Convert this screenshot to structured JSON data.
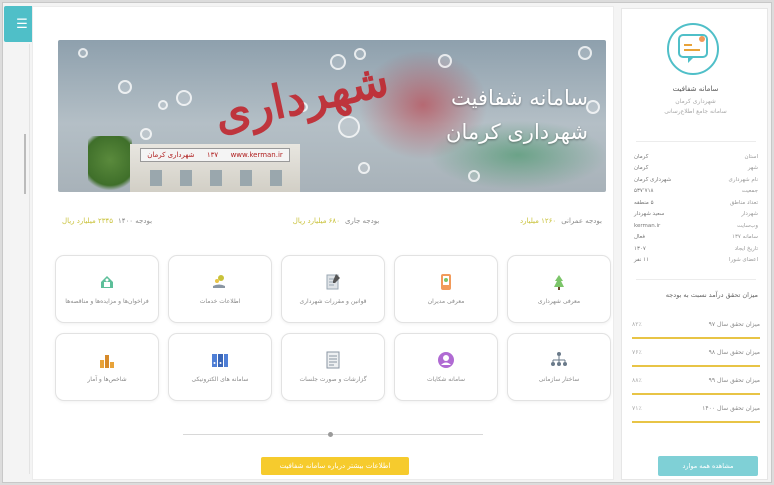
{
  "app": {
    "toggle_icon": "menu-icon"
  },
  "banner": {
    "title_line1": "سامانه شفافیت",
    "title_line2": "شهرداری کرمان",
    "script_text": "شهرداری",
    "sign_text": "شهرداری کرمان",
    "sign_phone": "۱۳۷",
    "sign_site": "www.kerman.ir"
  },
  "stats": [
    {
      "label": "بودجه ۱۴۰۰",
      "value": "۲۳۴۵ میلیارد ریال"
    },
    {
      "label": "بودجه جاری",
      "value": "۶۸۰ میلیارد ریال"
    },
    {
      "label": "بودجه عمرانی",
      "value": "۱۲۶۰ میلیارد"
    }
  ],
  "cards": [
    {
      "label": "معرفی شهرداری",
      "icon": "building-flag-icon",
      "color": "#7cc56a"
    },
    {
      "label": "معرفی مدیران",
      "icon": "phone-users-icon",
      "color": "#f29a5a"
    },
    {
      "label": "قوانین و مقررات شهرداری",
      "icon": "document-pen-icon",
      "color": "#9aa7b3"
    },
    {
      "label": "اطلاعات خدمات",
      "icon": "hand-coins-icon",
      "color": "#c9c23a"
    },
    {
      "label": "فراخوان‌ها و مزایده‌ها و مناقصه‌ها",
      "icon": "megaphone-icon",
      "color": "#5dbf9a"
    },
    {
      "label": "ساختار سازمانی",
      "icon": "org-chart-icon",
      "color": "#6a7a8a"
    },
    {
      "label": "سامانه شکایات",
      "icon": "person-circle-icon",
      "color": "#b06ad3"
    },
    {
      "label": "گزارشات و صورت جلسات",
      "icon": "report-sheet-icon",
      "color": "#8a96a3"
    },
    {
      "label": "سامانه های الکترونیکی",
      "icon": "binders-icon",
      "color": "#4f7fd6"
    },
    {
      "label": "شاخص‌ها و آمار",
      "icon": "bar-chart-icon",
      "color": "#e8a33a"
    }
  ],
  "cta": {
    "label": "اطلاعات بیشتر درباره سامانه شفافیت"
  },
  "sidebar": {
    "logo_icon": "transparency-logo-icon",
    "title": "سامانه شفافیت",
    "subtitle_line1": "شهرداری کرمان",
    "subtitle_line2": "سامانه جامع اطلاع‌رسانی",
    "info": [
      {
        "k": "استان",
        "v": "کرمان"
      },
      {
        "k": "شهر",
        "v": "کرمان"
      },
      {
        "k": "نام شهرداری",
        "v": "شهرداری کرمان"
      },
      {
        "k": "جمعیت",
        "v": "۵۳۷٬۷۱۸"
      },
      {
        "k": "تعداد مناطق",
        "v": "۵ منطقه"
      },
      {
        "k": "شهردار",
        "v": "سعید شهردار"
      },
      {
        "k": "وب‌سایت",
        "v": "kerman.ir"
      },
      {
        "k": "سامانه ۱۳۷",
        "v": "فعال"
      },
      {
        "k": "تاریخ ایجاد",
        "v": "۱۳۰۷"
      },
      {
        "k": "اعضای شورا",
        "v": "۱۱ نفر"
      }
    ],
    "performance_title": "میزان تحقق درآمد نسبت به بودجه",
    "performance": [
      {
        "label": "میزان تحقق سال ۹۷",
        "pct": "۸۲٪"
      },
      {
        "label": "میزان تحقق سال ۹۸",
        "pct": "۷۶٪"
      },
      {
        "label": "میزان تحقق سال ۹۹",
        "pct": "۸۸٪"
      },
      {
        "label": "میزان تحقق سال ۱۴۰۰",
        "pct": "۷۱٪"
      }
    ],
    "button_label": "مشاهده همه موارد"
  }
}
